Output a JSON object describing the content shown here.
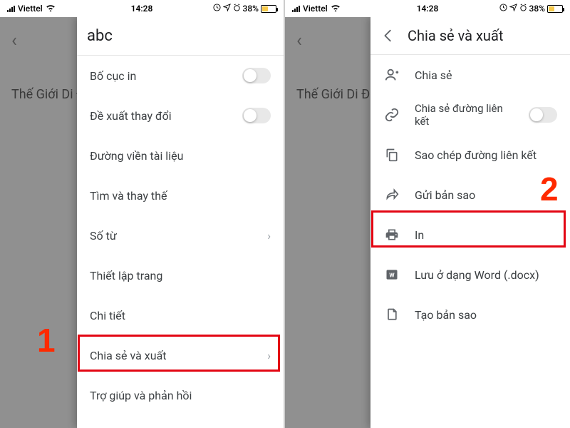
{
  "status": {
    "carrier": "Viettel",
    "time": "14:28",
    "battery_pct": "38%"
  },
  "bg": {
    "title": "Thế Giới Di Đ"
  },
  "left_panel": {
    "title": "abc",
    "items": {
      "print_layout": "Bố cục in",
      "suggest_changes": "Đề xuất thay đổi",
      "document_outline": "Đường viền tài liệu",
      "find_replace": "Tìm và thay thế",
      "word_count": "Số từ",
      "page_setup": "Thiết lập trang",
      "details": "Chi tiết",
      "share_export": "Chia sẻ và xuất",
      "help_feedback": "Trợ giúp và phản hồi"
    }
  },
  "right_panel": {
    "title": "Chia sẻ và xuất",
    "items": {
      "share": "Chia sẻ",
      "share_link": "Chia sẻ đường liên kết",
      "copy_link": "Sao chép đường liên kết",
      "send_copy": "Gửi bản sao",
      "print": "In",
      "save_word": "Lưu ở dạng Word (.docx)",
      "make_copy": "Tạo bản sao"
    }
  },
  "annotations": {
    "step1": "1",
    "step2": "2"
  }
}
